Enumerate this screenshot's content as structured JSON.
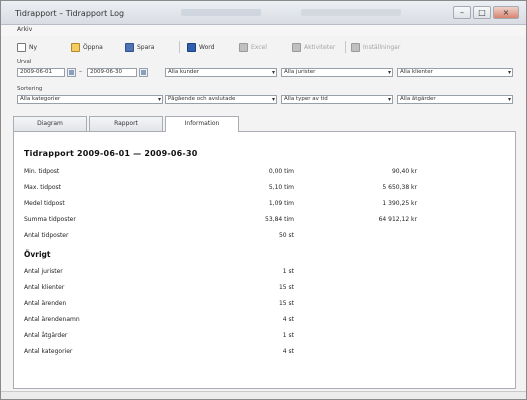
{
  "window": {
    "title": "Tidrapport – Tidrapport Log",
    "minimize": "–",
    "maximize": "□",
    "close": "×"
  },
  "menubar": {
    "menu": "Arkiv"
  },
  "toolbar": {
    "new": "Ny",
    "open": "Öppna",
    "save": "Spara",
    "word": "Word",
    "excel": "Excel",
    "tasks": "Aktiviteter",
    "settings": "Inställningar"
  },
  "filters": {
    "period_label": "Urval",
    "date_from": "2009-06-01",
    "date_to": "2009-06-30",
    "clients": "Alla kunder",
    "jurists": "Alla jurister",
    "clerks": "Alla klienter",
    "sorting_label": "Sortering",
    "categories": "Alla kategorier",
    "status": "Pågående och avslutade",
    "types": "Alla typer av tid",
    "measures": "Alla åtgärder"
  },
  "tabs": [
    "Diagram",
    "Rapport",
    "Information"
  ],
  "report": {
    "title": "Tidrapport 2009-06-01 — 2009-06-30",
    "rows": [
      {
        "label": "Min. tidpost",
        "value1": "0,00 tim",
        "value2": "90,40 kr"
      },
      {
        "label": "Max. tidpost",
        "value1": "5,10 tim",
        "value2": "5 650,38 kr"
      },
      {
        "label": "Medel tidpost",
        "value1": "1,09 tim",
        "value2": "1 390,25 kr"
      },
      {
        "label": "Summa tidposter",
        "value1": "53,84 tim",
        "value2": "64 912,12 kr"
      },
      {
        "label": "Antal tidposter",
        "value1": "50 st",
        "value2": ""
      }
    ],
    "other_heading": "Övrigt",
    "other_rows": [
      {
        "label": "Antal jurister",
        "value": "1 st"
      },
      {
        "label": "Antal klienter",
        "value": "15 st"
      },
      {
        "label": "Antal ärenden",
        "value": "15 st"
      },
      {
        "label": "Antal ärendenamn",
        "value": "4 st"
      },
      {
        "label": "Antal åtgärder",
        "value": "1 st"
      },
      {
        "label": "Antal kategorier",
        "value": "4 st"
      }
    ]
  }
}
